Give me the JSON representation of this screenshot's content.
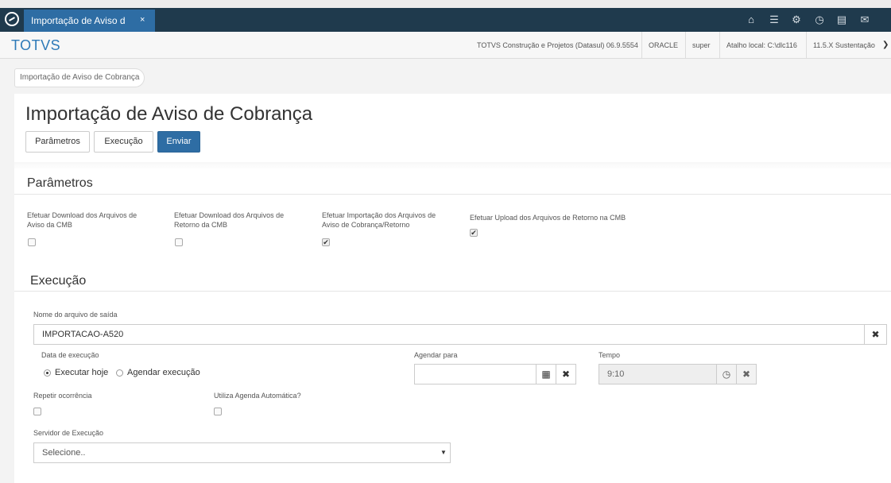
{
  "tab": {
    "title": "Importação de Aviso d",
    "close_icon": "×"
  },
  "brand": "TOTVS",
  "header_info": [
    "TOTVS Construção e Projetos (Datasul) 06.9.5554",
    "ORACLE",
    "super",
    "Atalho local: C:\\dlc116",
    "11.5.X Sustentação"
  ],
  "topbar_icons": [
    "home-icon",
    "sitemap-icon",
    "gear-icon",
    "clock-icon",
    "document-icon",
    "mail-icon"
  ],
  "breadcrumb": "Importação de Aviso de Cobrança",
  "page_title": "Importação de Aviso de Cobrança",
  "buttons": {
    "parametros": "Parâmetros",
    "execucao": "Execução",
    "enviar": "Enviar"
  },
  "parametros": {
    "title": "Parâmetros",
    "options": [
      {
        "label": "Efetuar Download dos Arquivos de Aviso da CMB",
        "checked": false
      },
      {
        "label": "Efetuar Download dos Arquivos de Retorno da CMB",
        "checked": false
      },
      {
        "label": "Efetuar Importação dos Arquivos de Aviso de Cobrança/Retorno",
        "checked": true
      },
      {
        "label": "Efetuar Upload dos Arquivos de Retorno na CMB",
        "checked": true
      }
    ]
  },
  "execucao": {
    "title": "Execução",
    "nome_arquivo_label": "Nome do arquivo de saída",
    "nome_arquivo_value": "IMPORTACAO-A520",
    "data_execucao_label": "Data de execução",
    "radio_hoje": "Executar hoje",
    "radio_agendar": "Agendar execução",
    "agendar_para_label": "Agendar para",
    "agendar_para_value": "",
    "tempo_label": "Tempo",
    "tempo_value": "9:10",
    "repetir_label": "Repetir ocorrência",
    "agenda_auto_label": "Utiliza Agenda Automática?",
    "servidor_label": "Servidor de Execução",
    "servidor_placeholder": "Selecione.."
  },
  "colors": {
    "accent": "#2e6da4",
    "topbar": "#1f3a4d",
    "brand": "#2e7ab8"
  }
}
